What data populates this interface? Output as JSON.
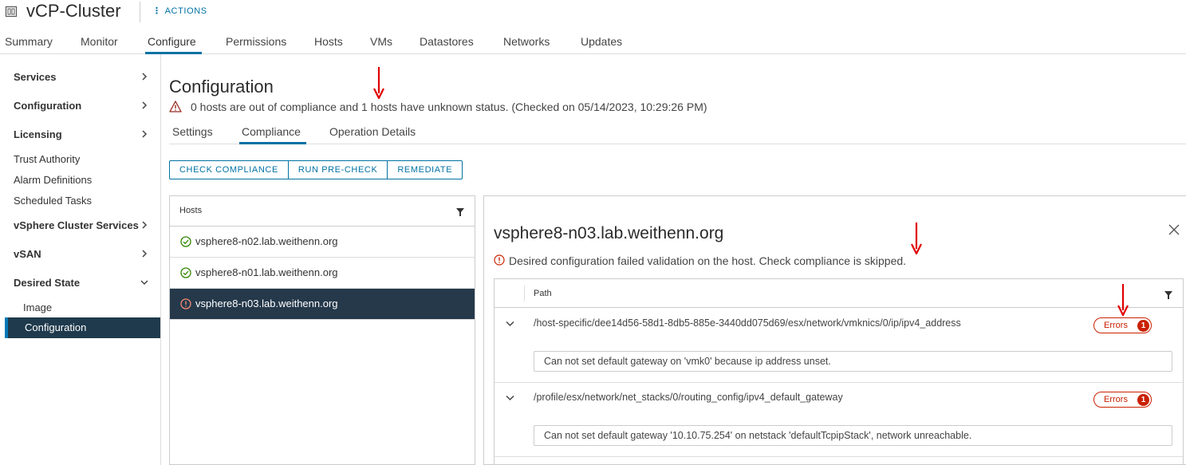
{
  "header": {
    "title": "vCP-Cluster",
    "actions_label": "ACTIONS",
    "tabs": [
      "Summary",
      "Monitor",
      "Configure",
      "Permissions",
      "Hosts",
      "VMs",
      "Datastores",
      "Networks",
      "Updates"
    ],
    "active_tab": "Configure"
  },
  "sidebar": {
    "items": [
      {
        "label": "Services",
        "bold": true,
        "expandable": true
      },
      {
        "label": "Configuration",
        "bold": true,
        "expandable": true
      },
      {
        "label": "Licensing",
        "bold": true,
        "expandable": true
      },
      {
        "label": "Trust Authority",
        "bold": false
      },
      {
        "label": "Alarm Definitions",
        "bold": false
      },
      {
        "label": "Scheduled Tasks",
        "bold": false
      },
      {
        "label": "vSphere Cluster Services",
        "bold": true,
        "expandable": true
      },
      {
        "label": "vSAN",
        "bold": true,
        "expandable": true
      },
      {
        "label": "Desired State",
        "bold": true,
        "expanded": true
      },
      {
        "label": "Image",
        "bold": false,
        "child": true
      },
      {
        "label": "Configuration",
        "bold": false,
        "child": true,
        "selected": true
      }
    ]
  },
  "main": {
    "title": "Configuration",
    "warning": "0 hosts are out of compliance and 1 hosts have unknown status. (Checked on 05/14/2023, 10:29:26 PM)",
    "tabs": [
      "Settings",
      "Compliance",
      "Operation Details"
    ],
    "active_tab": "Compliance",
    "buttons": [
      "CHECK COMPLIANCE",
      "RUN PRE-CHECK",
      "REMEDIATE"
    ]
  },
  "hosts": {
    "header": "Hosts",
    "rows": [
      {
        "name": "vsphere8-n02.lab.weithenn.org",
        "status": "compliant"
      },
      {
        "name": "vsphere8-n01.lab.weithenn.org",
        "status": "compliant"
      },
      {
        "name": "vsphere8-n03.lab.weithenn.org",
        "status": "error",
        "selected": true
      }
    ]
  },
  "detail": {
    "title": "vsphere8-n03.lab.weithenn.org",
    "error_message": "Desired configuration failed validation on the host. Check compliance is skipped.",
    "column_path": "Path",
    "rows": [
      {
        "path": "/host-specific/dee14d56-58d1-8db5-885e-3440dd075d69/esx/network/vmknics/0/ip/ipv4_address",
        "badge_label": "Errors",
        "badge_count": "1",
        "message": "Can not set default gateway on 'vmk0' because ip address unset."
      },
      {
        "path": "/profile/esx/network/net_stacks/0/routing_config/ipv4_default_gateway",
        "badge_label": "Errors",
        "badge_count": "1",
        "message": "Can not set default gateway '10.10.75.254' on netstack 'defaultTcpipStack', network unreachable."
      }
    ]
  },
  "colors": {
    "accent": "#0072a3",
    "selected_bg": "#25394b",
    "error": "#c92100",
    "success": "#318700",
    "annotation": "#e00000"
  }
}
